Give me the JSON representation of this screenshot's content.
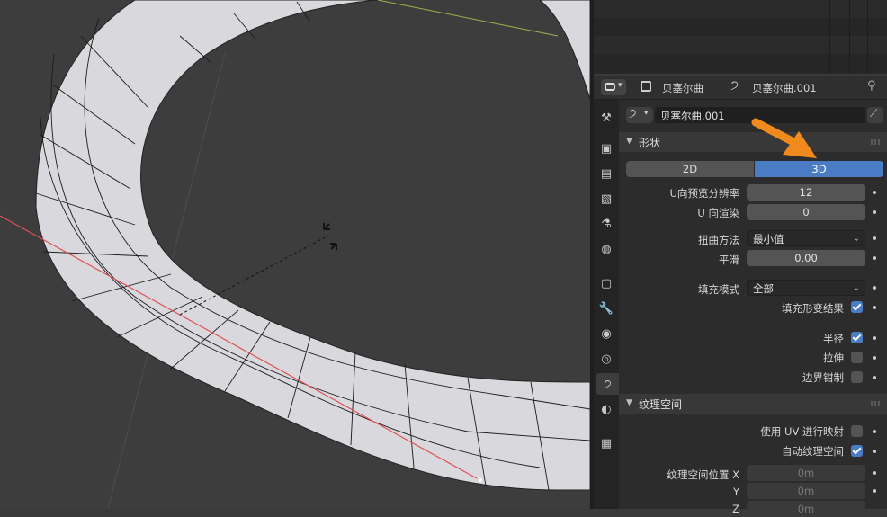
{
  "header": {
    "object_name": "贝塞尔曲",
    "data_name": "贝塞尔曲.001"
  },
  "datablock": {
    "name": "贝塞尔曲.001"
  },
  "shape_panel": {
    "title": "形状",
    "mode_2d": "2D",
    "mode_3d": "3D",
    "active_mode": "3D",
    "u_preview_label": "U向预览分辨率",
    "u_preview_value": "12",
    "u_render_label": "U 向渲染",
    "u_render_value": "0",
    "twist_label": "扭曲方法",
    "twist_value": "最小值",
    "smooth_label": "平滑",
    "smooth_value": "0.00",
    "fill_label": "填充模式",
    "fill_value": "全部",
    "fill_deformed_label": "填充形变结果",
    "fill_deformed_checked": true,
    "radius_label": "半径",
    "radius_checked": true,
    "stretch_label": "拉伸",
    "stretch_checked": false,
    "bounds_clamp_label": "边界钳制",
    "bounds_clamp_checked": false
  },
  "texture_panel": {
    "title": "纹理空间",
    "use_uv_label": "使用 UV 进行映射",
    "use_uv_checked": false,
    "auto_texspace_label": "自动纹理空间",
    "auto_texspace_checked": true,
    "location_label": "纹理空间位置 X",
    "loc_y_label": "Y",
    "loc_z_label": "Z",
    "loc_x_value": "0m",
    "loc_y_value": "0m",
    "loc_z_value": "0m"
  },
  "colors": {
    "accent_blue": "#4a7bc5",
    "arrow_orange": "#f08a1c",
    "x_axis_red": "#e0505a",
    "y_axis_green": "#9ab34c",
    "mesh_white": "#d9d9dd"
  },
  "icons": [
    "tools-icon",
    "render-icon",
    "output-icon",
    "view-layer-icon",
    "scene-icon",
    "world-icon",
    "object-icon",
    "modifier-icon",
    "particles-icon",
    "physics-icon",
    "curve-data-icon",
    "material-icon",
    "texture-icon"
  ]
}
